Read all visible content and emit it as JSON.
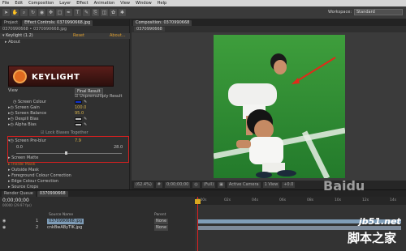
{
  "menus": [
    "File",
    "Edit",
    "Composition",
    "Layer",
    "Effect",
    "Animation",
    "View",
    "Window",
    "Help"
  ],
  "workspace": {
    "label": "Workspace:",
    "value": "Standard"
  },
  "left_tabs": [
    "Project",
    "Effect Controls: 0370990668.jpg"
  ],
  "effect_header": "0370990668 • 0370990668.jpg",
  "effect": {
    "name": "Keylight (1.2)",
    "reset": "Reset",
    "about": "About...",
    "about_label": "About",
    "logo": "KEYLIGHT",
    "view_label": "View",
    "view_value": "Final Result",
    "unpremult": "Unpremultiply Result",
    "screen_colour": "Screen Colour",
    "screen_gain": "Screen Gain",
    "screen_gain_val": "100.0",
    "screen_balance": "Screen Balance",
    "screen_balance_val": "95.0",
    "despill": "Despill Bias",
    "alpha_bias": "Alpha Bias",
    "lock": "Lock Biases Together",
    "preblur": "Screen Pre-blur",
    "preblur_val": "7.9",
    "range_min": "0.0",
    "range_max": "28.0",
    "screen_matte": "Screen Matte",
    "inside_mask": "Inside Mask",
    "outside_mask": "Outside Mask",
    "fg_colour": "Foreground Colour Correction",
    "edge_colour": "Edge Colour Correction",
    "source_crops": "Source Crops"
  },
  "comp": {
    "tab": "Composition: 0370990668",
    "sub": "0370990668",
    "zoom": "(62.4%)",
    "time": "0;00;00;00",
    "quality": "(Full)",
    "camera": "Active Camera",
    "view": "1 View",
    "extra": "+0.0"
  },
  "timeline": {
    "tabs": [
      "Render Queue",
      "0370990668"
    ],
    "time": "0;00;00;00",
    "fps": "00000 (29.97 fps)",
    "col_source": "Source Name",
    "col_parent": "Parent",
    "ticks": [
      "0:00s",
      "02s",
      "04s",
      "06s",
      "08s",
      "10s",
      "12s",
      "14s"
    ],
    "layers": [
      {
        "num": "1",
        "name": "0370990668.jpg",
        "parent": "None"
      },
      {
        "num": "2",
        "name": "cnkBwAByTIK.jpg",
        "parent": "None"
      }
    ]
  },
  "watermarks": {
    "baidu": "Baidu",
    "site": "jb51.net",
    "cn": "脚本之家"
  },
  "colors": {
    "screen_colour": "#1133cc",
    "layer1": "#7f9db8",
    "layer2": "#7d8a9a"
  }
}
